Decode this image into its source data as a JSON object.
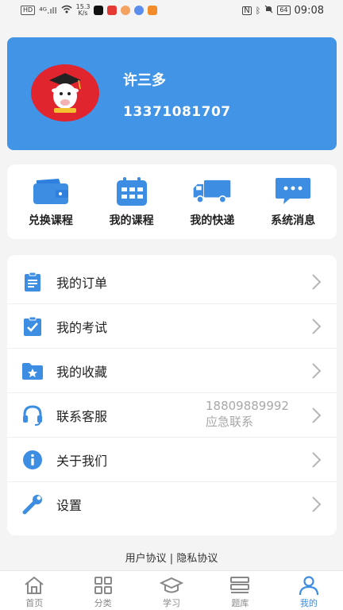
{
  "status_bar": {
    "network_tag": "HD",
    "signal": "⁴ᴳ.ıll",
    "speed_value": "15.3",
    "speed_unit": "K/s",
    "battery": "64",
    "time": "09:08"
  },
  "profile": {
    "name": "许三多",
    "phone": "13371081707"
  },
  "quick_actions": [
    {
      "label": "兑换课程",
      "icon": "wallet-icon"
    },
    {
      "label": "我的课程",
      "icon": "calendar-icon"
    },
    {
      "label": "我的快递",
      "icon": "truck-icon"
    },
    {
      "label": "系统消息",
      "icon": "message-icon"
    }
  ],
  "menu": [
    {
      "label": "我的订单",
      "icon": "clipboard-icon"
    },
    {
      "label": "我的考试",
      "icon": "checklist-icon"
    },
    {
      "label": "我的收藏",
      "icon": "star-folder-icon"
    },
    {
      "label": "联系客服",
      "icon": "headset-icon",
      "extra_line1": "18809889992",
      "extra_line2": "应急联系"
    },
    {
      "label": "关于我们",
      "icon": "info-icon"
    },
    {
      "label": "设置",
      "icon": "wrench-icon"
    }
  ],
  "agreement": {
    "user": "用户协议",
    "separator": " | ",
    "privacy": "隐私协议"
  },
  "tabs": [
    {
      "label": "首页",
      "icon": "home-icon"
    },
    {
      "label": "分类",
      "icon": "grid-icon"
    },
    {
      "label": "学习",
      "icon": "graduation-cap-icon"
    },
    {
      "label": "题库",
      "icon": "stack-icon"
    },
    {
      "label": "我的",
      "icon": "user-icon",
      "active": true
    }
  ],
  "colors": {
    "primary": "#4294e6",
    "icon_blue": "#3d8de3",
    "avatar_bg": "#e1252f"
  }
}
